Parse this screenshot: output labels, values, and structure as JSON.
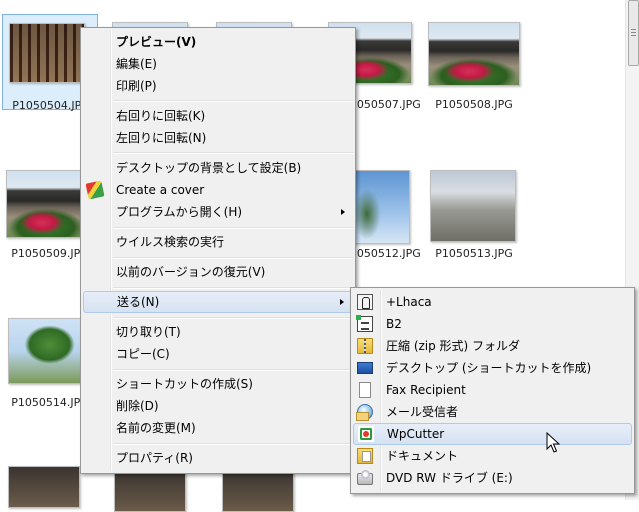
{
  "files": [
    {
      "name": "P1050504.JPG",
      "photo": "corridor",
      "selected": true
    },
    {
      "name": "",
      "photo": "temple"
    },
    {
      "name": "",
      "photo": "temple"
    },
    {
      "name": "P1050507.JPG",
      "photo": "temple"
    },
    {
      "name": "P1050508.JPG",
      "photo": "temple"
    },
    {
      "name": "P1050509.JPG",
      "photo": "temple"
    },
    {
      "name": "P1050512.JPG",
      "photo": "sky"
    },
    {
      "name": "P1050513.JPG",
      "photo": "street"
    },
    {
      "name": "P1050514.JPG",
      "photo": "tree"
    }
  ],
  "context_menu": {
    "items": [
      {
        "label": "プレビュー(V)",
        "bold": true
      },
      {
        "label": "編集(E)"
      },
      {
        "label": "印刷(P)"
      },
      {
        "label": "右回りに回転(K)"
      },
      {
        "label": "左回りに回転(N)"
      },
      {
        "label": "デスクトップの背景として設定(B)"
      },
      {
        "label": "Create a cover",
        "icon": "create-cover-icon"
      },
      {
        "label": "プログラムから開く(H)",
        "submenu": true
      },
      {
        "label": "ウイルス検索の実行"
      },
      {
        "label": "以前のバージョンの復元(V)"
      },
      {
        "label": "送る(N)",
        "submenu": true,
        "highlighted": true
      },
      {
        "label": "切り取り(T)"
      },
      {
        "label": "コピー(C)"
      },
      {
        "label": "ショートカットの作成(S)"
      },
      {
        "label": "削除(D)"
      },
      {
        "label": "名前の変更(M)"
      },
      {
        "label": "プロパティ(R)"
      }
    ]
  },
  "send_to_menu": {
    "items": [
      {
        "label": "+Lhaca",
        "icon": "lhaca-icon"
      },
      {
        "label": "B2",
        "icon": "b2-icon"
      },
      {
        "label": "圧縮 (zip 形式) フォルダ",
        "icon": "zip-folder-icon"
      },
      {
        "label": "デスクトップ (ショートカットを作成)",
        "icon": "desktop-icon"
      },
      {
        "label": "Fax Recipient",
        "icon": "fax-icon"
      },
      {
        "label": "メール受信者",
        "icon": "mail-recipient-icon"
      },
      {
        "label": "WpCutter",
        "icon": "wpcutter-icon",
        "highlighted": true
      },
      {
        "label": "ドキュメント",
        "icon": "documents-icon"
      },
      {
        "label": "DVD RW ドライブ (E:)",
        "icon": "dvd-drive-icon"
      }
    ]
  },
  "colors": {
    "menu_bg": "#f0f0f0",
    "highlight_border": "#aecbec",
    "selection_bg": "#dceefc"
  }
}
